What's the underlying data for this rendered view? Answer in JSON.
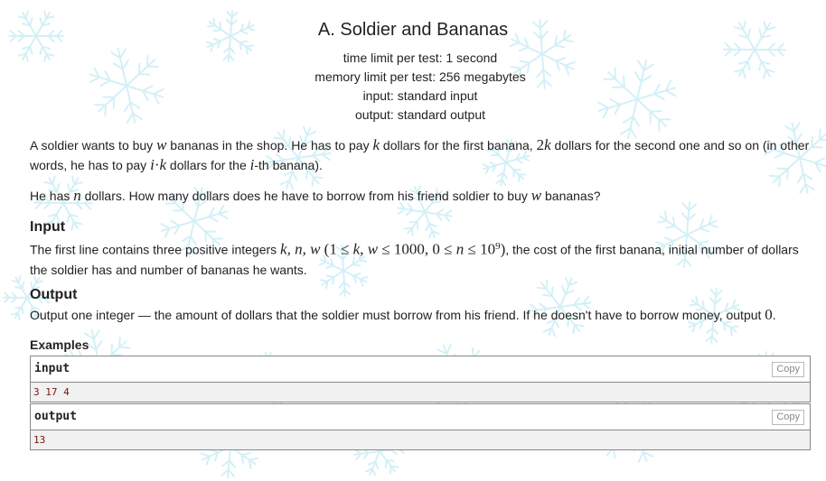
{
  "problem": {
    "title": "A. Soldier and Bananas",
    "time_limit": "time limit per test: 1 second",
    "memory_limit": "memory limit per test: 256 megabytes",
    "input_file": "input: standard input",
    "output_file": "output: standard output"
  },
  "statement": {
    "p1_a": "A soldier wants to buy ",
    "p1_w": "w",
    "p1_b": " bananas in the shop. He has to pay ",
    "p1_k": "k",
    "p1_c": " dollars for the first banana, ",
    "p1_2k": "2",
    "p1_2k_var": "k",
    "p1_d": " dollars for the second one and so on (in other words, he has to pay ",
    "p1_i": "i",
    "p1_dot": "·",
    "p1_k2": "k",
    "p1_e": " dollars for the ",
    "p1_i2": "i",
    "p1_f": "-th banana).",
    "p2_a": "He has ",
    "p2_n": "n",
    "p2_b": " dollars. How many dollars does he have to borrow from his friend soldier to buy ",
    "p2_w": "w",
    "p2_c": " bananas?"
  },
  "input_section": {
    "title": "Input",
    "a": "The first line contains three positive integers ",
    "vars": "k, n, w",
    "cons_open": " (1 ≤ ",
    "cons_k": "k",
    "cons_comma": ", ",
    "cons_w": "w",
    "cons_mid": " ≤ 1000, 0 ≤ ",
    "cons_n": "n",
    "cons_le": " ≤ 10",
    "cons_exp": "9",
    "cons_close": ")",
    "b": ", the cost of the first banana, initial number of dollars the soldier has and number of bananas he wants."
  },
  "output_section": {
    "title": "Output",
    "a": "Output one integer — the amount of dollars that the soldier must borrow from his friend. If he doesn't have to borrow money, output ",
    "zero": "0",
    "b": "."
  },
  "examples": {
    "title": "Examples",
    "copy_label": "Copy",
    "input_label": "input",
    "input_value": "3 17 4",
    "output_label": "output",
    "output_value": "13"
  },
  "colors": {
    "background": "#ffffff",
    "snowflake": "#cdeef6",
    "sample_bg": "#f1f1f1",
    "sample_text": "#7a1212"
  },
  "icons": [
    "snowflake-background"
  ]
}
